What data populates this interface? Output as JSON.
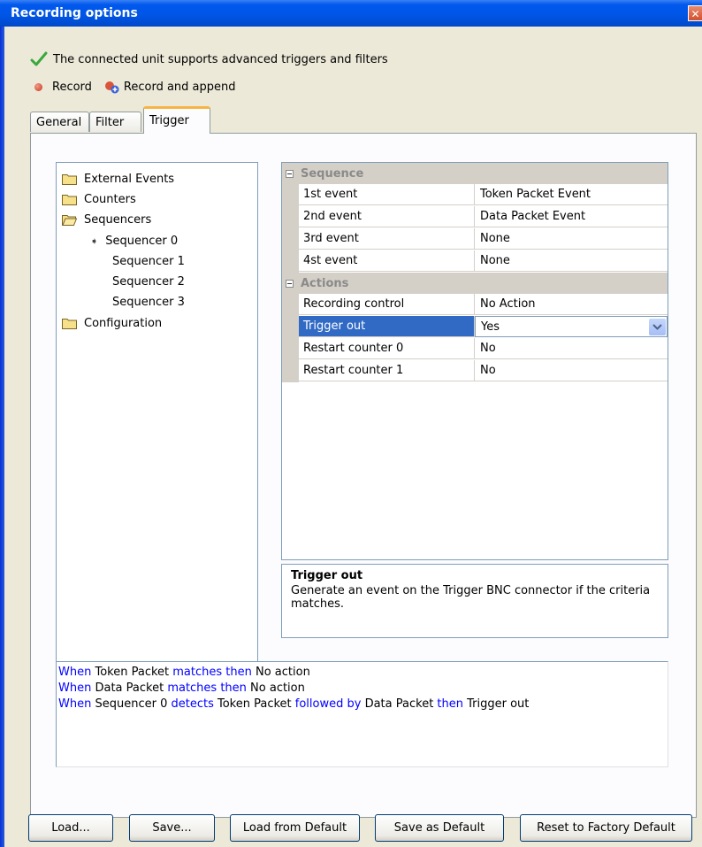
{
  "window": {
    "title": "Recording options",
    "close_label": "✕"
  },
  "support_message": "The connected unit supports advanced triggers and filters",
  "record": {
    "record_label": "Record",
    "append_label": "Record and append"
  },
  "tabs": [
    {
      "label": "General"
    },
    {
      "label": "Filter"
    },
    {
      "label": "Trigger",
      "active": true
    }
  ],
  "tree": {
    "items": [
      {
        "label": "External Events"
      },
      {
        "label": "Counters"
      },
      {
        "label": "Sequencers"
      },
      {
        "label": "Sequencer 0"
      },
      {
        "label": "Sequencer 1"
      },
      {
        "label": "Sequencer 2"
      },
      {
        "label": "Sequencer 3"
      },
      {
        "label": "Configuration"
      }
    ]
  },
  "grid": {
    "sequence": {
      "title": "Sequence",
      "rows": [
        {
          "name": "1st event",
          "value": "Token Packet Event"
        },
        {
          "name": "2nd event",
          "value": "Data Packet Event"
        },
        {
          "name": "3rd event",
          "value": "None"
        },
        {
          "name": "4st event",
          "value": "None"
        }
      ]
    },
    "actions": {
      "title": "Actions",
      "rows": [
        {
          "name": "Recording control",
          "value": "No Action"
        },
        {
          "name": "Trigger out",
          "value": "Yes"
        },
        {
          "name": "Restart counter 0",
          "value": "No"
        },
        {
          "name": "Restart counter 1",
          "value": "No"
        }
      ]
    }
  },
  "description": {
    "title": "Trigger out",
    "text": "Generate an event on the Trigger BNC connector if the criteria matches."
  },
  "summary": {
    "line1": {
      "a": "When",
      "b": " Token Packet ",
      "c": "matches then",
      "d": " No action"
    },
    "line2": {
      "a": "When",
      "b": " Data Packet ",
      "c": "matches then",
      "d": " No action"
    },
    "line3": {
      "a": "When",
      "b": " Sequencer 0 ",
      "c": "detects",
      "d": " Token Packet ",
      "e": "followed by",
      "f": " Data Packet ",
      "g": "then",
      "h": " Trigger out"
    }
  },
  "buttons": {
    "load": "Load...",
    "save": "Save...",
    "load_default": "Load from Default",
    "save_default": "Save as Default",
    "reset_factory": "Reset to Factory Default"
  },
  "colors": {
    "title_bar": "#0055e5",
    "selection": "#316ac5",
    "keyword": "#0000ff",
    "active_tab_accent": "#f7b442"
  }
}
